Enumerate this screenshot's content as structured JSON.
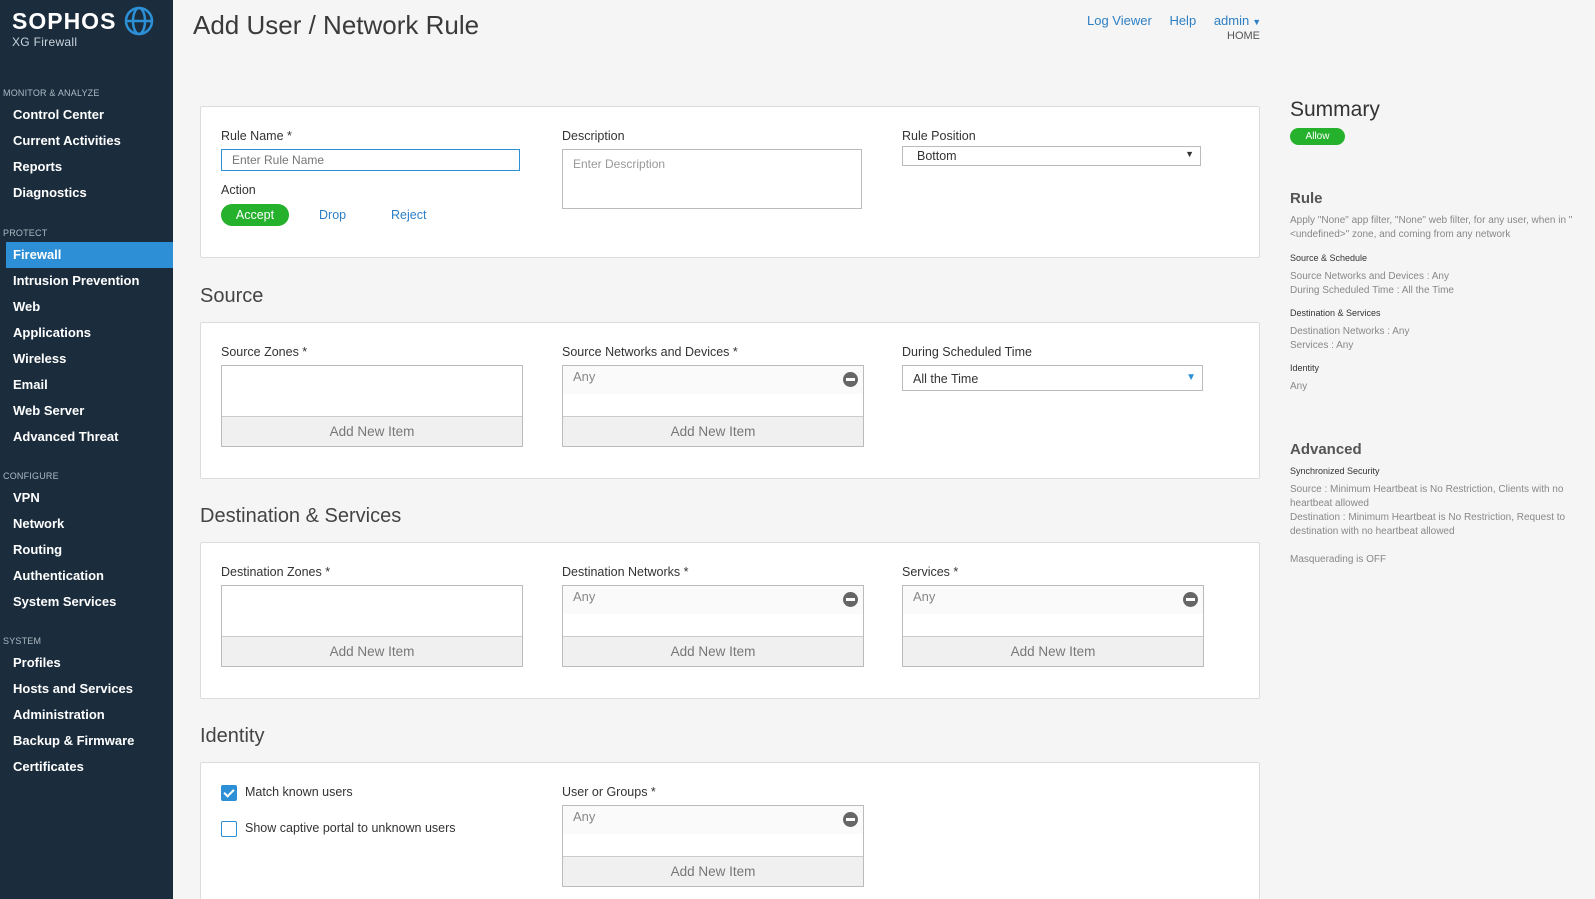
{
  "brand": {
    "name": "SOPHOS",
    "product": "XG Firewall"
  },
  "sidebar": {
    "sections": [
      {
        "header": "MONITOR & ANALYZE",
        "items": [
          "Control Center",
          "Current Activities",
          "Reports",
          "Diagnostics"
        ]
      },
      {
        "header": "PROTECT",
        "items": [
          "Firewall",
          "Intrusion Prevention",
          "Web",
          "Applications",
          "Wireless",
          "Email",
          "Web Server",
          "Advanced Threat"
        ]
      },
      {
        "header": "CONFIGURE",
        "items": [
          "VPN",
          "Network",
          "Routing",
          "Authentication",
          "System Services"
        ]
      },
      {
        "header": "SYSTEM",
        "items": [
          "Profiles",
          "Hosts and Services",
          "Administration",
          "Backup & Firmware",
          "Certificates"
        ]
      }
    ],
    "active_item": "Firewall"
  },
  "page": {
    "title": "Add User / Network Rule"
  },
  "topnav": {
    "log_viewer": "Log Viewer",
    "help": "Help",
    "admin": "admin",
    "home": "HOME"
  },
  "rule": {
    "name_label": "Rule Name *",
    "name_placeholder": "Enter Rule Name",
    "description_label": "Description",
    "description_placeholder": "Enter Description",
    "position_label": "Rule Position",
    "position_value": "Bottom",
    "action_label": "Action",
    "actions": {
      "accept": "Accept",
      "drop": "Drop",
      "reject": "Reject"
    }
  },
  "source": {
    "title": "Source",
    "zones_label": "Source Zones *",
    "networks_label": "Source Networks and Devices *",
    "networks_value": "Any",
    "schedule_label": "During Scheduled Time",
    "schedule_value": "All the Time"
  },
  "destination": {
    "title": "Destination & Services",
    "zones_label": "Destination Zones *",
    "networks_label": "Destination Networks *",
    "networks_value": "Any",
    "services_label": "Services *",
    "services_value": "Any"
  },
  "identity": {
    "title": "Identity",
    "match_known": "Match known users",
    "match_known_checked": true,
    "captive_portal": "Show captive portal to unknown users",
    "captive_portal_checked": false,
    "users_label": "User or Groups *",
    "users_value": "Any"
  },
  "common": {
    "add_new_item": "Add New Item"
  },
  "summary": {
    "title": "Summary",
    "badge": "Allow",
    "rule_heading": "Rule",
    "rule_text": "Apply \"None\" app filter, \"None\" web filter, for any user, when in \"<undefined>\" zone, and coming from any network",
    "source_schedule_heading": "Source & Schedule",
    "source_networks": "Source Networks and Devices : Any",
    "scheduled_time": "During Scheduled Time : All the Time",
    "dest_services_heading": "Destination & Services",
    "dest_networks": "Destination Networks : Any",
    "services": "Services : Any",
    "identity_heading": "Identity",
    "identity_value": "Any",
    "advanced_heading": "Advanced",
    "sync_sec_heading": "Synchronized Security",
    "sync_source": "Source : Minimum Heartbeat is No Restriction, Clients with no heartbeat allowed",
    "sync_dest": "Destination : Minimum Heartbeat is No Restriction, Request to destination with no heartbeat allowed",
    "masquerading": "Masquerading is OFF"
  },
  "colors": {
    "sidebar_bg": "#1b2d3d",
    "active": "#2d8fd5",
    "accept_green": "#25b12c",
    "link": "#2d7fc4"
  }
}
